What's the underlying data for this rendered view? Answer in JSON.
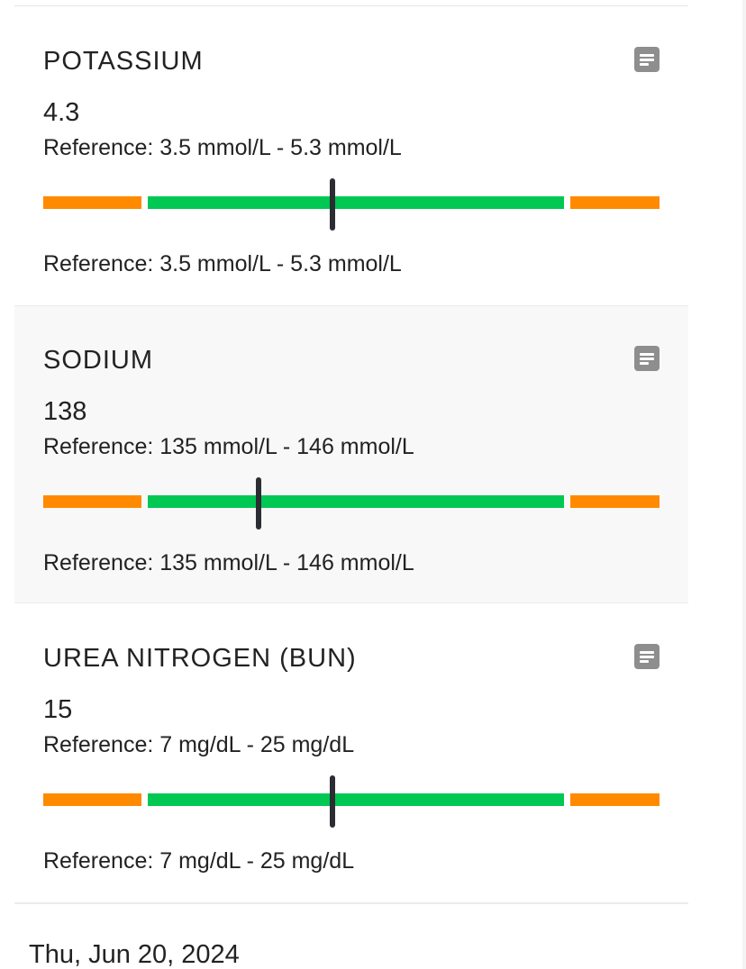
{
  "colors": {
    "out_of_range": "#ff8a00",
    "in_range": "#00c853",
    "marker": "#2b2d33"
  },
  "results": [
    {
      "name": "POTASSIUM",
      "value": "4.3",
      "reference": "Reference: 3.5 mmol/L - 5.3 mmol/L",
      "reference_footer": "Reference: 3.5 mmol/L - 5.3 mmol/L",
      "notes_icon": "notes-icon",
      "range_position": 0.47
    },
    {
      "name": "SODIUM",
      "value": "138",
      "reference": "Reference: 135 mmol/L - 146 mmol/L",
      "reference_footer": "Reference: 135 mmol/L - 146 mmol/L",
      "notes_icon": "notes-icon",
      "range_position": 0.35
    },
    {
      "name": "UREA NITROGEN (BUN)",
      "value": "15",
      "reference": "Reference: 7 mg/dL - 25 mg/dL",
      "reference_footer": "Reference: 7 mg/dL - 25 mg/dL",
      "notes_icon": "notes-icon",
      "range_position": 0.47
    }
  ],
  "next_section": {
    "date": "Thu, Jun 20, 2024"
  }
}
